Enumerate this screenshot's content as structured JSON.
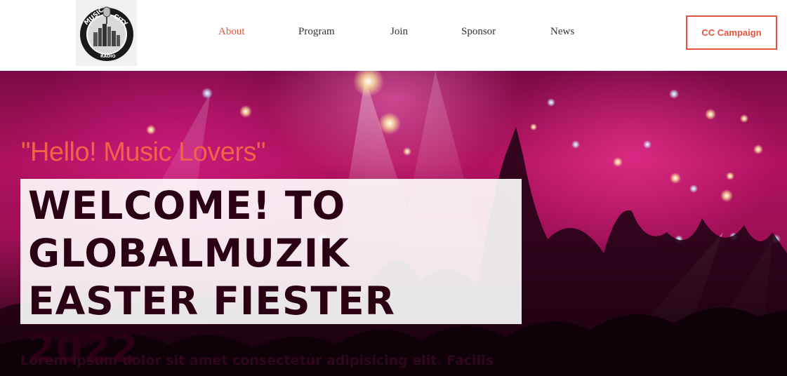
{
  "header": {
    "logo": {
      "text_top": "MUSIC CITY",
      "text_bottom": "RADIO",
      "icon": "microphone-city-logo"
    },
    "nav": [
      {
        "label": "About",
        "active": true
      },
      {
        "label": "Program",
        "active": false
      },
      {
        "label": "Join",
        "active": false
      },
      {
        "label": "Sponsor",
        "active": false
      },
      {
        "label": "News",
        "active": false
      }
    ],
    "cta_label": "CC Campaign"
  },
  "hero": {
    "tagline": "\"Hello! Music Lovers\"",
    "headline": "WELCOME! TO GLOBALMUZIK EASTER FIESTER 2022",
    "body": "Lorem ipsum dolor sit amet consectetur adipisicing elit. Facilis"
  },
  "colors": {
    "accent": "#e8533f",
    "nav_text": "#333333",
    "headline_text": "#2b0013"
  }
}
